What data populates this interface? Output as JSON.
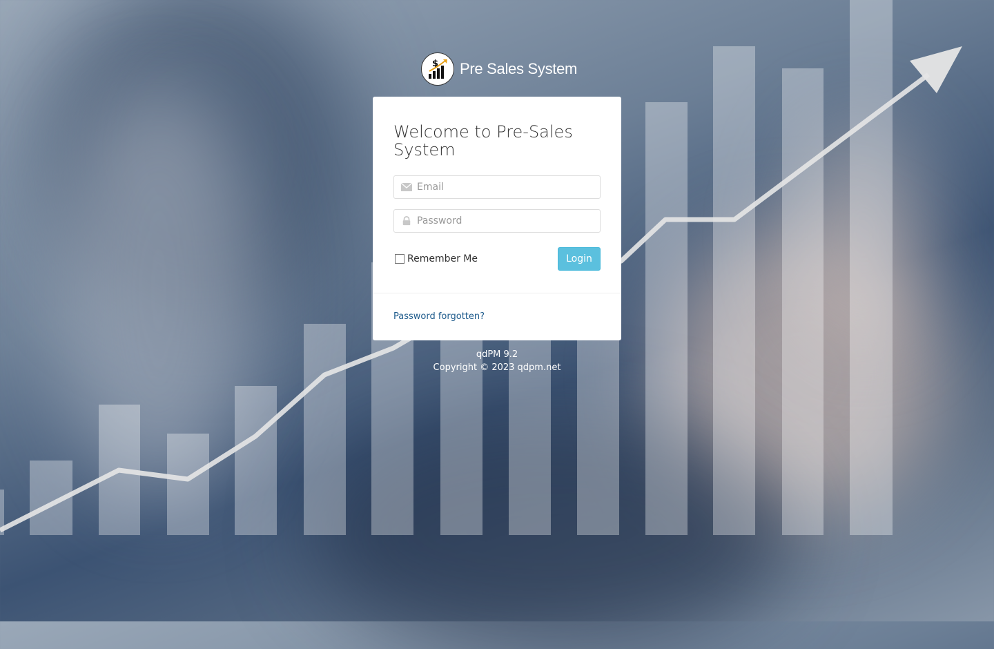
{
  "brand": {
    "name": "Pre Sales System",
    "logo_icon": "dollar-growth-chart-icon"
  },
  "login": {
    "title": "Welcome to Pre-Sales System",
    "email_placeholder": "Email",
    "email_value": "",
    "password_placeholder": "Password",
    "password_value": "",
    "remember_label": "Remember Me",
    "remember_checked": false,
    "login_button": "Login",
    "forgot_link": "Password forgotten?"
  },
  "footer": {
    "version": "qdPM 9.2",
    "copyright": "Copyright © 2023 qdpm.net"
  },
  "colors": {
    "accent": "#5bc0de",
    "link": "#1e5b8c",
    "card": "#ffffff"
  }
}
